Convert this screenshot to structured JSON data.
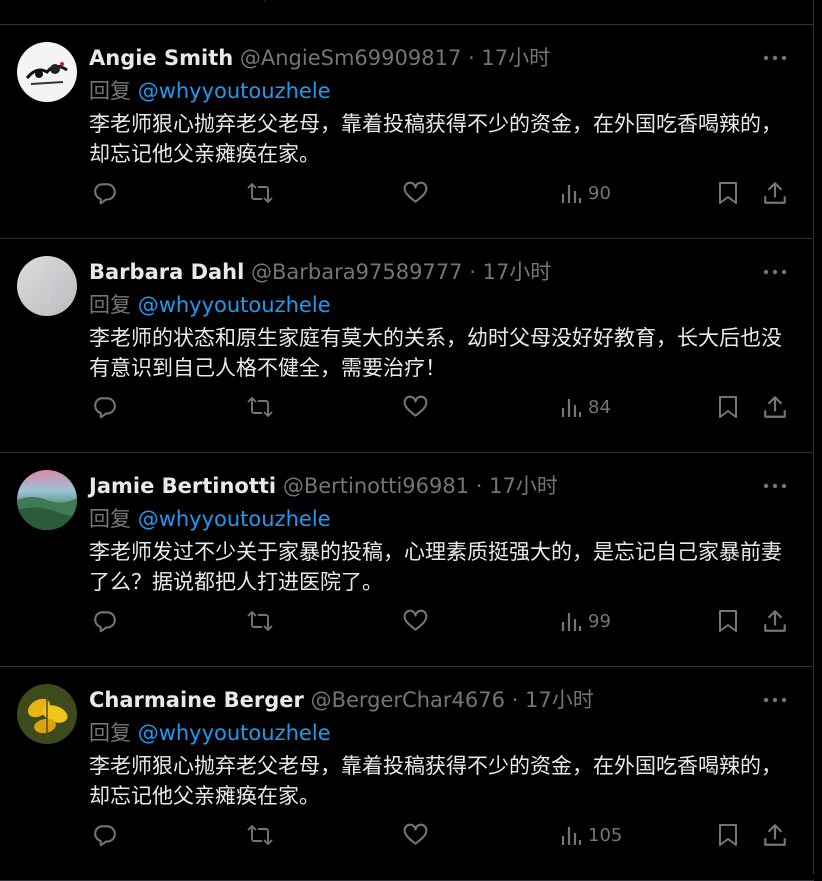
{
  "colors": {
    "background": "#000000",
    "text": "#e7e9ea",
    "secondary": "#71767b",
    "link": "#1d9bf0",
    "divider": "#2f3336"
  },
  "reply_prefix": "回复",
  "separator": "·",
  "tweets": [
    {
      "name": "Angie Smith",
      "handle": "@AngieSm69909817",
      "time": "17小时",
      "mention": "@whyyoutouzhele",
      "text": "李老师狠心抛弃老父老母，靠着投稿获得不少的资金，在外国吃香喝辣的，却忘记他父亲瘫痪在家。",
      "views": "90",
      "avatar": "ink-painting-avatar"
    },
    {
      "name": "Barbara Dahl",
      "handle": "@Barbara97589777",
      "time": "17小时",
      "mention": "@whyyoutouzhele",
      "text": "李老师的状态和原生家庭有莫大的关系，幼时父母没好好教育，长大后也没有意识到自己人格不健全，需要治疗！",
      "views": "84",
      "avatar": "gray-gradient-avatar"
    },
    {
      "name": "Jamie Bertinotti",
      "handle": "@Bertinotti96981",
      "time": "17小时",
      "mention": "@whyyoutouzhele",
      "text": "李老师发过不少关于家暴的投稿，心理素质挺强大的，是忘记自己家暴前妻了么？据说都把人打进医院了。",
      "views": "99",
      "avatar": "landscape-avatar"
    },
    {
      "name": "Charmaine Berger",
      "handle": "@BergerChar4676",
      "time": "17小时",
      "mention": "@whyyoutouzhele",
      "text": "李老师狠心抛弃老父老母，靠着投稿获得不少的资金，在外国吃香喝辣的，却忘记他父亲瘫痪在家。",
      "views": "105",
      "avatar": "yellow-leaves-avatar"
    }
  ]
}
